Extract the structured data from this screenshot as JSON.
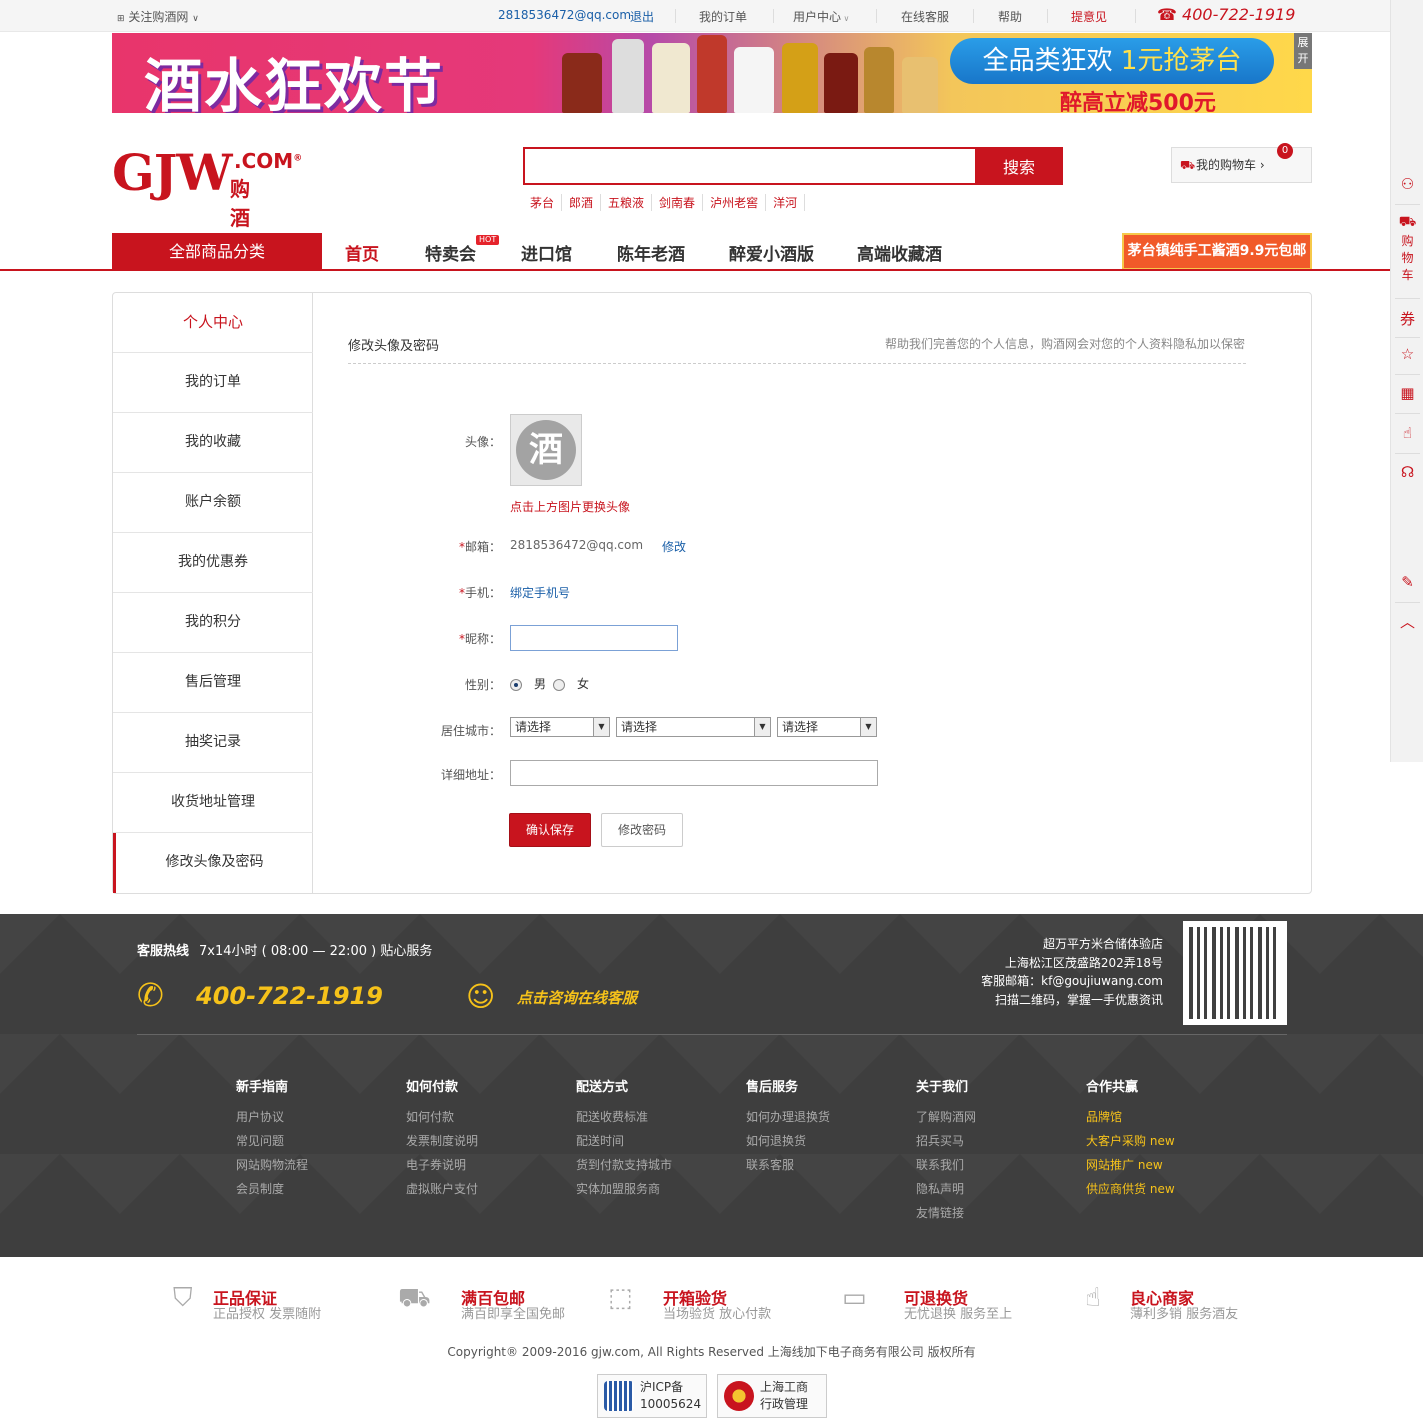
{
  "topbar": {
    "follow": "关注购酒网",
    "email": "2818536472@qq.com",
    "logout": "退出",
    "orders": "我的订单",
    "user_center": "用户中心",
    "service": "在线客服",
    "help": "帮助",
    "feedback": "提意见",
    "phone": "400-722-1919"
  },
  "banner": {
    "title": "酒水狂欢节",
    "pill_prefix": "全品类狂欢 ",
    "pill_highlight": "1元抢茅台",
    "sub": "醉高立减500元",
    "expand": "展开"
  },
  "header": {
    "logo_main": "GJW",
    "logo_com": ".COM",
    "logo_reg": "®",
    "logo_cn": "购酒网",
    "search_button": "搜索",
    "search_value": "",
    "hotwords": [
      "茅台",
      "郎酒",
      "五粮液",
      "剑南春",
      "泸州老窖",
      "洋河"
    ],
    "cart_label": "我的购物车",
    "cart_count": "0"
  },
  "nav": {
    "all_categories": "全部商品分类",
    "items": [
      "首页",
      "特卖会",
      "进口馆",
      "陈年老酒",
      "醉爱小酒版",
      "高端收藏酒"
    ],
    "hot_badge": "HOT",
    "promo": "茅台镇纯手工酱酒9.9元包邮"
  },
  "sidebar": {
    "heading": "个人中心",
    "items": [
      "我的订单",
      "我的收藏",
      "账户余额",
      "我的优惠券",
      "我的积分",
      "售后管理",
      "抽奖记录",
      "收货地址管理",
      "修改头像及密码"
    ]
  },
  "form": {
    "title": "修改头像及密码",
    "hint": "帮助我们完善您的个人信息，购酒网会对您的个人资料隐私加以保密",
    "avatar_label": "头像：",
    "avatar_glyph": "酒",
    "avatar_change": "点击上方图片更换头像",
    "email_label": "邮箱：",
    "email_value": "2818536472@qq.com",
    "email_edit": "修改",
    "phone_label": "手机：",
    "phone_bind": "绑定手机号",
    "nickname_label": "昵称：",
    "nickname_value": "",
    "gender_label": "性别：",
    "gender_male": "男",
    "gender_female": "女",
    "city_label": "居住城市：",
    "city_selects": [
      "请选择",
      "请选择",
      "请选择"
    ],
    "address_label": "详细地址：",
    "address_value": "",
    "required_mark": "*",
    "save_button": "确认保存",
    "password_button": "修改密码"
  },
  "right_sidebar": {
    "cart_text": "购物车",
    "coupon_glyph": "券"
  },
  "footer": {
    "hotline_label": "客服热线",
    "hotline_hours": "7x14小时 ( 08:00 — 22:00 ) 贴心服务",
    "phone": "400-722-1919",
    "online_service": "点击咨询在线客服",
    "store_lines": [
      "超万平方米合储体验店",
      "上海松江区茂盛路202弄18号",
      "客服邮箱：kf@goujiuwang.com",
      "扫描二维码，掌握一手优惠资讯"
    ],
    "columns": [
      {
        "heading": "新手指南",
        "links": [
          "用户协议",
          "常见问题",
          "网站购物流程",
          "会员制度"
        ]
      },
      {
        "heading": "如何付款",
        "links": [
          "如何付款",
          "发票制度说明",
          "电子券说明",
          "虚拟账户支付"
        ]
      },
      {
        "heading": "配送方式",
        "links": [
          "配送收费标准",
          "配送时间",
          "货到付款支持城市",
          "实体加盟服务商"
        ]
      },
      {
        "heading": "售后服务",
        "links": [
          "如何办理退换货",
          "如何退换货",
          "联系客服"
        ]
      },
      {
        "heading": "关于我们",
        "links": [
          "了解购酒网",
          "招兵买马",
          "联系我们",
          "隐私声明",
          "友情链接"
        ]
      },
      {
        "heading": "合作共赢",
        "links": [
          "品牌馆",
          "大客户采购",
          "网站推广",
          "供应商供货"
        ],
        "new_tag": "new"
      }
    ]
  },
  "guarantees": [
    {
      "title": "正品保证",
      "sub": "正品授权 发票随附"
    },
    {
      "title": "满百包邮",
      "sub": "满百即享全国免邮"
    },
    {
      "title": "开箱验货",
      "sub": "当场验货 放心付款"
    },
    {
      "title": "可退换货",
      "sub": "无忧退换 服务至上"
    },
    {
      "title": "良心商家",
      "sub": "薄利多销 服务酒友"
    }
  ],
  "copyright": "Copyright® 2009-2016 gjw.com, All Rights Reserved 上海线加下电子商务有限公司 版权所有",
  "certs": [
    {
      "line1": "沪ICP备",
      "line2": "10005624"
    },
    {
      "line1": "上海工商",
      "line2": "行政管理"
    }
  ],
  "colors": {
    "brand_red": "#c8141e",
    "link_blue": "#1a5fa8",
    "footer_bg": "#3e3e3e",
    "footer_yellow": "#f6c21a"
  }
}
